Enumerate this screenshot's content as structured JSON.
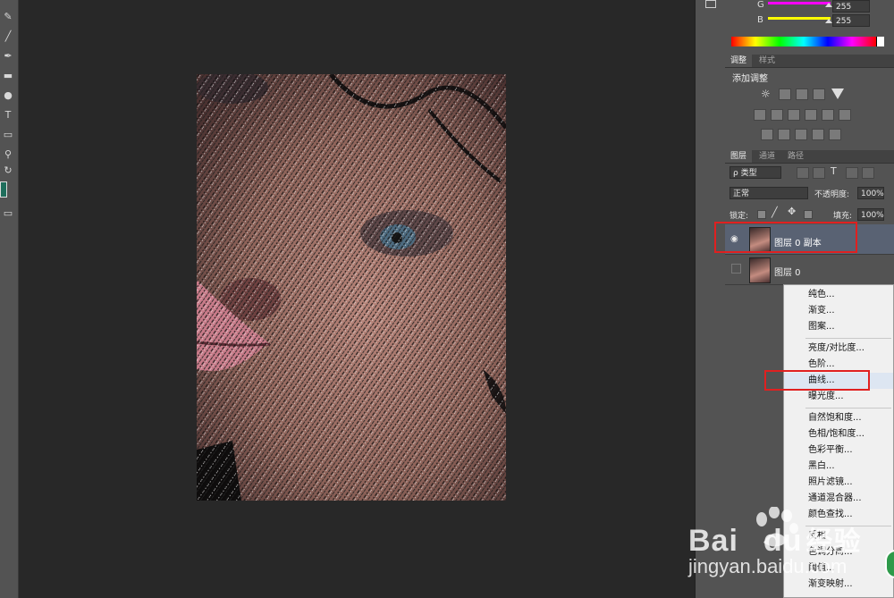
{
  "color_panel": {
    "g_label": "G",
    "g_value": "255",
    "b_label": "B",
    "b_value": "255",
    "g_color": "#ff00ff",
    "b_color": "#ffff00"
  },
  "adjustments_panel": {
    "tabs": [
      "调整",
      "样式"
    ],
    "heading": "添加调整"
  },
  "layers_panel": {
    "tabs": [
      "图层",
      "通道",
      "路径"
    ],
    "filter_kind": "ρ 类型",
    "blend_mode": "正常",
    "opacity_label": "不透明度:",
    "opacity_value": "100%",
    "lock_label": "锁定:",
    "fill_label": "填充:",
    "fill_value": "100%",
    "layers": [
      {
        "name": "图层 0 副本",
        "visible": true,
        "selected": true
      },
      {
        "name": "图层 0",
        "visible": false,
        "selected": false
      }
    ]
  },
  "context_menu": {
    "group1": [
      "纯色...",
      "渐变...",
      "图案..."
    ],
    "group2": [
      "亮度/对比度...",
      "色阶...",
      "曲线...",
      "曝光度..."
    ],
    "group3": [
      "自然饱和度...",
      "色相/饱和度...",
      "色彩平衡...",
      "黑白...",
      "照片滤镜...",
      "通道混合器...",
      "颜色查找..."
    ],
    "group4": [
      "反相",
      "色调分离...",
      "阈值...",
      "渐变映射..."
    ],
    "highlighted": "曲线..."
  },
  "watermark": {
    "brand": "Bai",
    "brand_tail": "du",
    "product": "经验",
    "url": "jingyan.baidu.com"
  }
}
